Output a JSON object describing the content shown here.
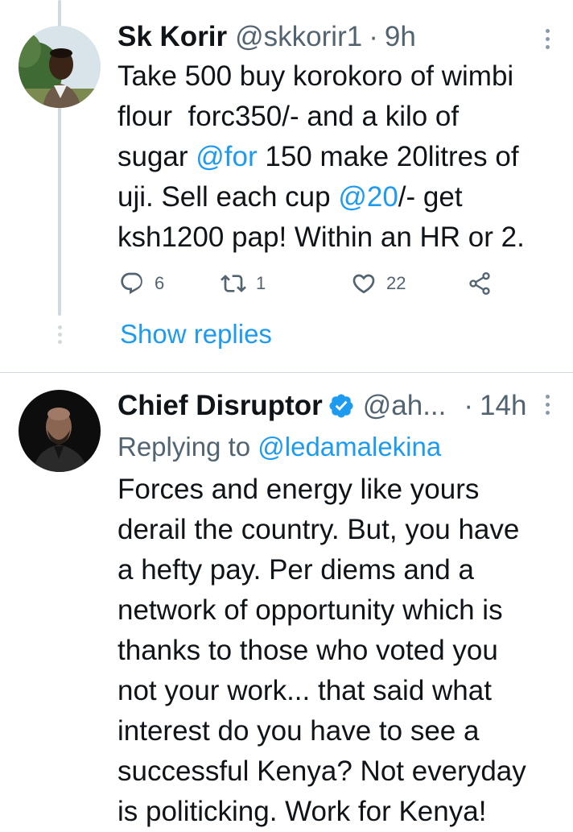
{
  "tweet1": {
    "name": "Sk Korir",
    "handle": "@skkorir1",
    "separator": "·",
    "time": "9h",
    "text_parts": [
      {
        "t": "Take 500 buy korokoro of wimbi\nflour  forc350/- and a kilo of\nsugar "
      },
      {
        "t": "@for",
        "link": true
      },
      {
        "t": " 150 make 20litres of\nuji. Sell each cup "
      },
      {
        "t": "@20",
        "link": true
      },
      {
        "t": "/- get\nksh1200 pap! Within an HR or 2."
      }
    ],
    "reply_count": "6",
    "retweet_count": "1",
    "like_count": "22",
    "icons": {
      "reply": "reply-icon",
      "retweet": "retweet-icon",
      "like": "like-icon",
      "share": "share-icon",
      "more": "more-icon"
    }
  },
  "show_replies_label": "Show replies",
  "tweet2": {
    "name": "Chief Disruptor",
    "handle": "@ah...",
    "separator": "·",
    "time": "14h",
    "replying_prefix": "Replying to ",
    "replying_handle": "@ledamalekina",
    "text": "Forces and energy like yours\nderail the country. But, you have\na hefty pay. Per diems and a\nnetwork of opportunity which is\nthanks to those who voted you\nnot your work... that said what\ninterest do you have to see a\nsuccessful Kenya? Not everyday\nis politicking. Work for Kenya!",
    "verified_icon": "verified-badge-icon"
  },
  "colors": {
    "accent": "#1d9bf0",
    "muted": "#536471",
    "text": "#0f1419",
    "divider": "#cfd9de"
  }
}
